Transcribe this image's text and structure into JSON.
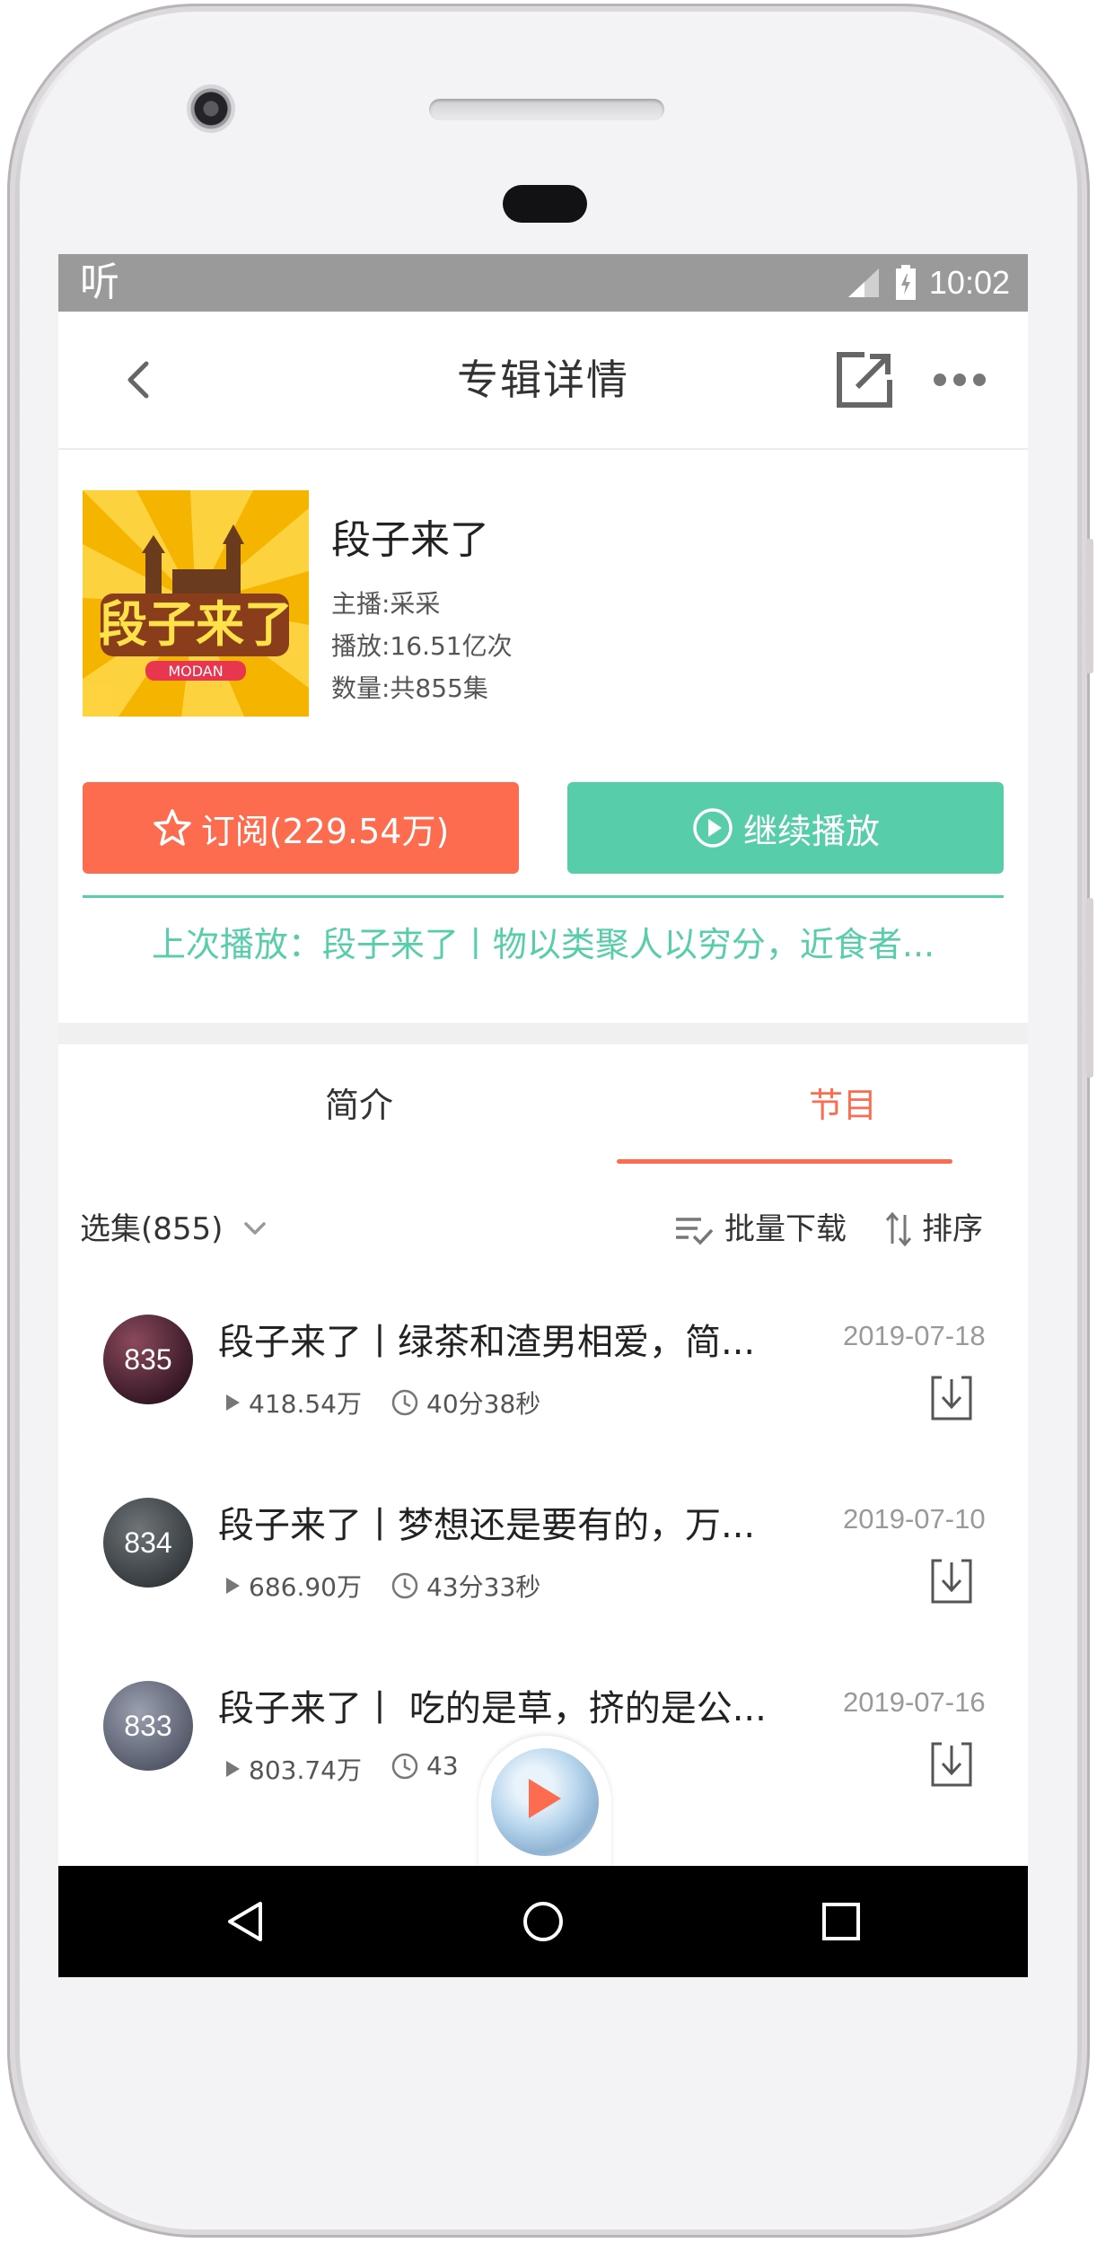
{
  "status_bar": {
    "app_label": "听",
    "time": "10:02"
  },
  "header": {
    "title": "专辑详情"
  },
  "album": {
    "title": "段子来了",
    "host": "主播:采采",
    "plays": "播放:16.51亿次",
    "count": "数量:共855集",
    "cover_text": "段子来了",
    "cover_sub": "MODAN"
  },
  "actions": {
    "subscribe_label": "订阅(229.54万)",
    "continue_label": "继续播放"
  },
  "last_played": "上次播放：段子来了丨物以类聚人以穷分，近食者...",
  "tabs": [
    {
      "label": "简介",
      "active": false
    },
    {
      "label": "节目",
      "active": true
    }
  ],
  "list_controls": {
    "select_label": "选集(855)",
    "batch_download_label": "批量下载",
    "sort_label": "排序"
  },
  "episodes": [
    {
      "number": "835",
      "title": "段子来了丨绿茶和渣男相爱，简...",
      "date": "2019-07-18",
      "plays": "418.54万",
      "duration": "40分38秒"
    },
    {
      "number": "834",
      "title": "段子来了丨梦想还是要有的，万...",
      "date": "2019-07-10",
      "plays": "686.90万",
      "duration": "43分33秒"
    },
    {
      "number": "833",
      "title": "段子来了丨 吃的是草，挤的是公...",
      "date": "2019-07-16",
      "plays": "803.74万",
      "duration": "43"
    }
  ],
  "colors": {
    "accent_orange": "#fd6c4f",
    "accent_teal": "#57cdaa",
    "status_bar": "#9a9a9a"
  },
  "icons": {
    "back": "chevron-left-icon",
    "share": "share-external-icon",
    "more": "more-dots-icon",
    "star": "star-icon",
    "play_circle": "play-circle-icon",
    "chevron_down": "chevron-down-icon",
    "batch": "checklist-icon",
    "sort": "sort-arrows-icon",
    "play_count": "play-triangle-icon",
    "clock": "clock-icon",
    "download": "download-icon"
  }
}
